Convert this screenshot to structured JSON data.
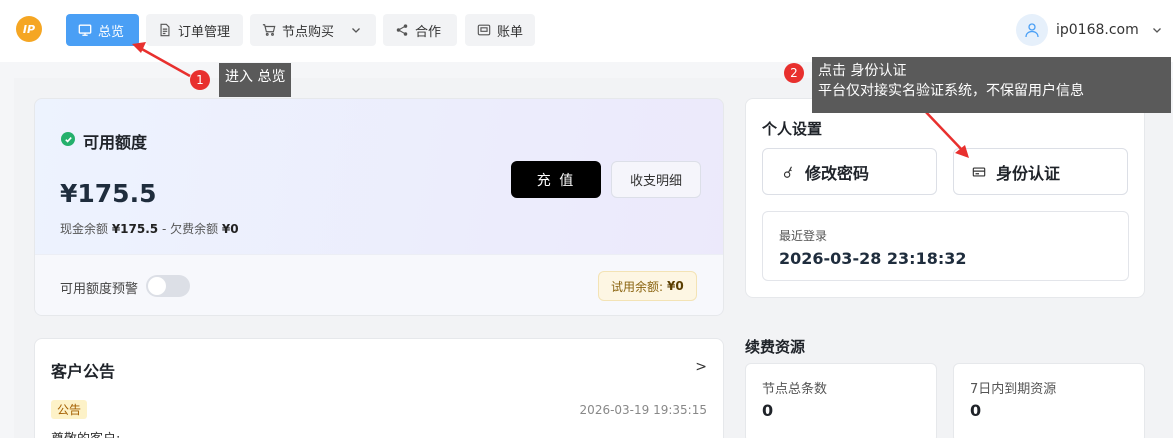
{
  "logo": {
    "text": "IP"
  },
  "nav": {
    "overview": "总览",
    "orders": "订单管理",
    "node_purchase": "节点购买",
    "cooperation": "合作",
    "bills": "账单"
  },
  "user": {
    "name": "ip0168.com"
  },
  "tips": {
    "tip1_num": "1",
    "tip1_text": "进入 总览",
    "tip2_num": "2",
    "tip2_line1": "点击 身份认证",
    "tip2_line2": "平台仅对接实名验证系统，不保留用户信息"
  },
  "credit": {
    "title": "可用额度",
    "amount": "¥175.5",
    "sub_prefix": "现金余额 ",
    "cash": "¥175.5",
    "sub_mid": " - 欠费余额 ",
    "debt": "¥0",
    "recharge_button": "充 值",
    "details_button": "收支明细",
    "warning_label": "可用额度预警",
    "warning_enabled": false,
    "trial_label": "试用余额:",
    "trial_value": "¥0"
  },
  "notice": {
    "title": "客户公告",
    "arrow": ">",
    "tag": "公告",
    "date": "2026-03-19 19:35:15",
    "text": "尊敬的客户:"
  },
  "personal": {
    "title": "个人设置",
    "change_password": "修改密码",
    "identity_verify": "身份认证",
    "last_login_label": "最近登录",
    "last_login_time": "2026-03-28 23:18:32"
  },
  "renew": {
    "title": "续费资源",
    "total_nodes_label": "节点总条数",
    "total_nodes_value": "0",
    "expiring_label": "7日内到期资源",
    "expiring_value": "0"
  },
  "colors": {
    "accent": "#4a9ff5",
    "tooltip": "#5a5a5a",
    "badge": "#e8302e",
    "arrow": "#e8302e"
  }
}
